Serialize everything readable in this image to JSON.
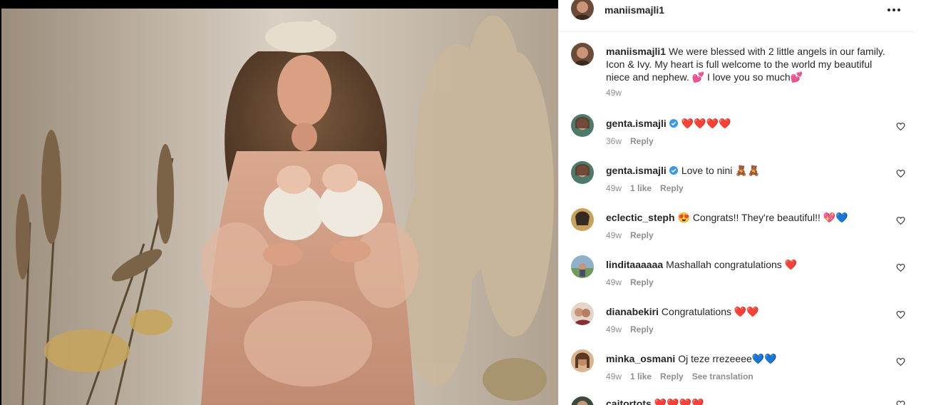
{
  "post": {
    "author": "maniismajli1",
    "caption_author": "maniismajli1",
    "caption_text": "We were blessed with 2 little angels in our family. Icon & Ivy. My heart is full welcome to the world my beautiful niece and nephew. 💕 I love you so much💕",
    "caption_time": "49w"
  },
  "comments": [
    {
      "user": "genta.ismajli",
      "verified": true,
      "text": "❤️❤️❤️❤️",
      "time": "36w",
      "likes": "",
      "reply": "Reply",
      "translate": ""
    },
    {
      "user": "genta.ismajli",
      "verified": true,
      "text": "Love to nini 🧸🧸",
      "time": "49w",
      "likes": "1 like",
      "reply": "Reply",
      "translate": ""
    },
    {
      "user": "eclectic_steph",
      "verified": false,
      "text": "😍 Congrats!! They're beautiful!! 💖💙",
      "time": "49w",
      "likes": "",
      "reply": "Reply",
      "translate": ""
    },
    {
      "user": "linditaaaaaa",
      "verified": false,
      "text": "Mashallah congratulations ❤️",
      "time": "49w",
      "likes": "",
      "reply": "Reply",
      "translate": ""
    },
    {
      "user": "dianabekiri",
      "verified": false,
      "text": "Congratulations ❤️❤️",
      "time": "49w",
      "likes": "",
      "reply": "Reply",
      "translate": ""
    },
    {
      "user": "minka_osmani",
      "verified": false,
      "text": "Oj teze rrezeeee💙💙",
      "time": "49w",
      "likes": "1 like",
      "reply": "Reply",
      "translate": "See translation"
    },
    {
      "user": "caitortots",
      "verified": false,
      "text": "❤️❤️❤️❤️",
      "time": "",
      "likes": "",
      "reply": "",
      "translate": ""
    }
  ],
  "colors": {
    "text": "#262626",
    "muted": "#8e8e8e",
    "verified": "#3897f0",
    "heart": "#ed4956",
    "divider": "#efefef"
  },
  "icons": {
    "more": "more-horizontal-icon",
    "like": "heart-outline-icon",
    "verified": "verified-badge-icon"
  }
}
